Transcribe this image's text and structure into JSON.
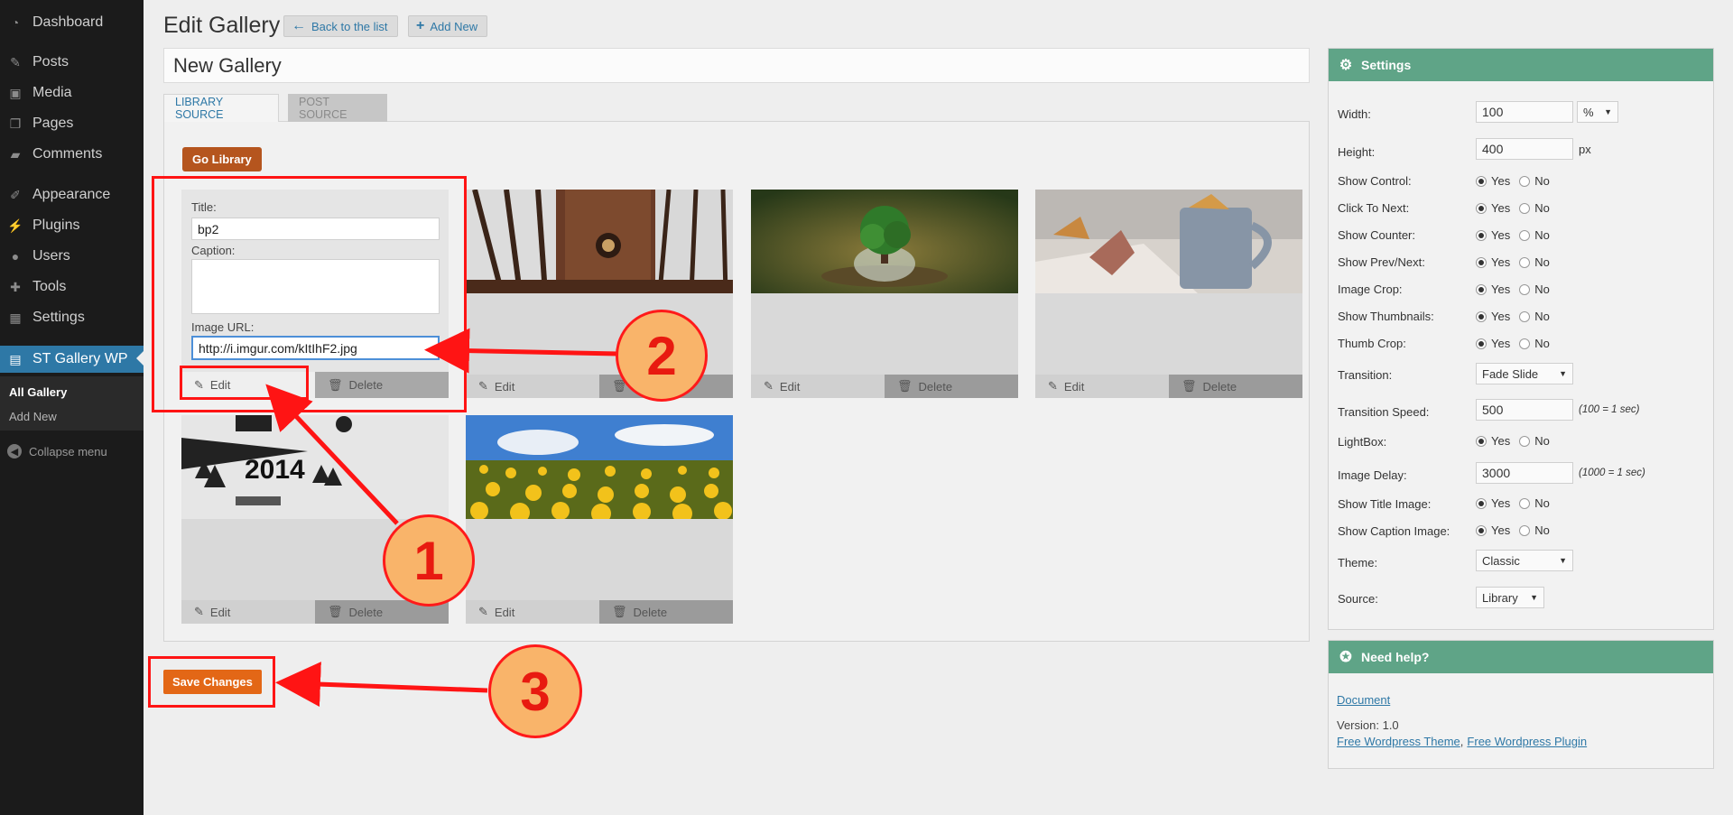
{
  "sidebar": {
    "items": [
      {
        "label": "Dashboard",
        "icon": "dashboard-icon"
      },
      {
        "label": "Posts",
        "icon": "pin-icon"
      },
      {
        "label": "Media",
        "icon": "media-icon"
      },
      {
        "label": "Pages",
        "icon": "pages-icon"
      },
      {
        "label": "Comments",
        "icon": "comment-icon"
      },
      {
        "label": "Appearance",
        "icon": "brush-icon"
      },
      {
        "label": "Plugins",
        "icon": "plug-icon"
      },
      {
        "label": "Users",
        "icon": "user-icon"
      },
      {
        "label": "Tools",
        "icon": "wrench-icon"
      },
      {
        "label": "Settings",
        "icon": "settings-icon"
      },
      {
        "label": "ST Gallery WP",
        "icon": "gallery-icon"
      }
    ],
    "submenu": [
      "All Gallery",
      "Add New"
    ],
    "collapse": "Collapse menu"
  },
  "header": {
    "title": "Edit Gallery",
    "back_label": "Back to the list",
    "add_new_label": "Add New"
  },
  "gallery_name": "New Gallery",
  "tabs": [
    "LIBRARY SOURCE",
    "POST SOURCE"
  ],
  "go_library": "Go Library",
  "edit_form": {
    "title_label": "Title:",
    "title_value": "bp2",
    "caption_label": "Caption:",
    "caption_value": "",
    "url_label": "Image URL:",
    "url_value": "http://i.imgur.com/kItIhF2.jpg"
  },
  "card_actions": {
    "edit": "Edit",
    "delete": "Delete"
  },
  "settings": {
    "title": "Settings",
    "width_label": "Width:",
    "width_value": "100",
    "width_unit": "%",
    "height_label": "Height:",
    "height_value": "400",
    "height_unit": "px",
    "yes": "Yes",
    "no": "No",
    "radio_rows": [
      {
        "label": "Show Control:"
      },
      {
        "label": "Click To Next:"
      },
      {
        "label": "Show Counter:"
      },
      {
        "label": "Show Prev/Next:"
      },
      {
        "label": "Image Crop:"
      },
      {
        "label": "Show Thumbnails:"
      },
      {
        "label": "Thumb Crop:"
      }
    ],
    "transition_label": "Transition:",
    "transition_value": "Fade Slide",
    "speed_label": "Transition Speed:",
    "speed_value": "500",
    "speed_note": "(100 = 1 sec)",
    "lightbox_label": "LightBox:",
    "delay_label": "Image Delay:",
    "delay_value": "3000",
    "delay_note": "(1000 = 1 sec)",
    "title_image_label": "Show Title Image:",
    "caption_image_label": "Show Caption Image:",
    "theme_label": "Theme:",
    "theme_value": "Classic",
    "source_label": "Source:",
    "source_value": "Library"
  },
  "help": {
    "title": "Need help?",
    "document": "Document",
    "version": "Version: 1.0",
    "theme_link": "Free Wordpress Theme",
    "separator": ",",
    "plugin_link": "Free Wordpress Plugin"
  },
  "save_label": "Save Changes",
  "annotations": {
    "step1": "1",
    "step2": "2",
    "step3": "3",
    "color": "#ff1414"
  }
}
